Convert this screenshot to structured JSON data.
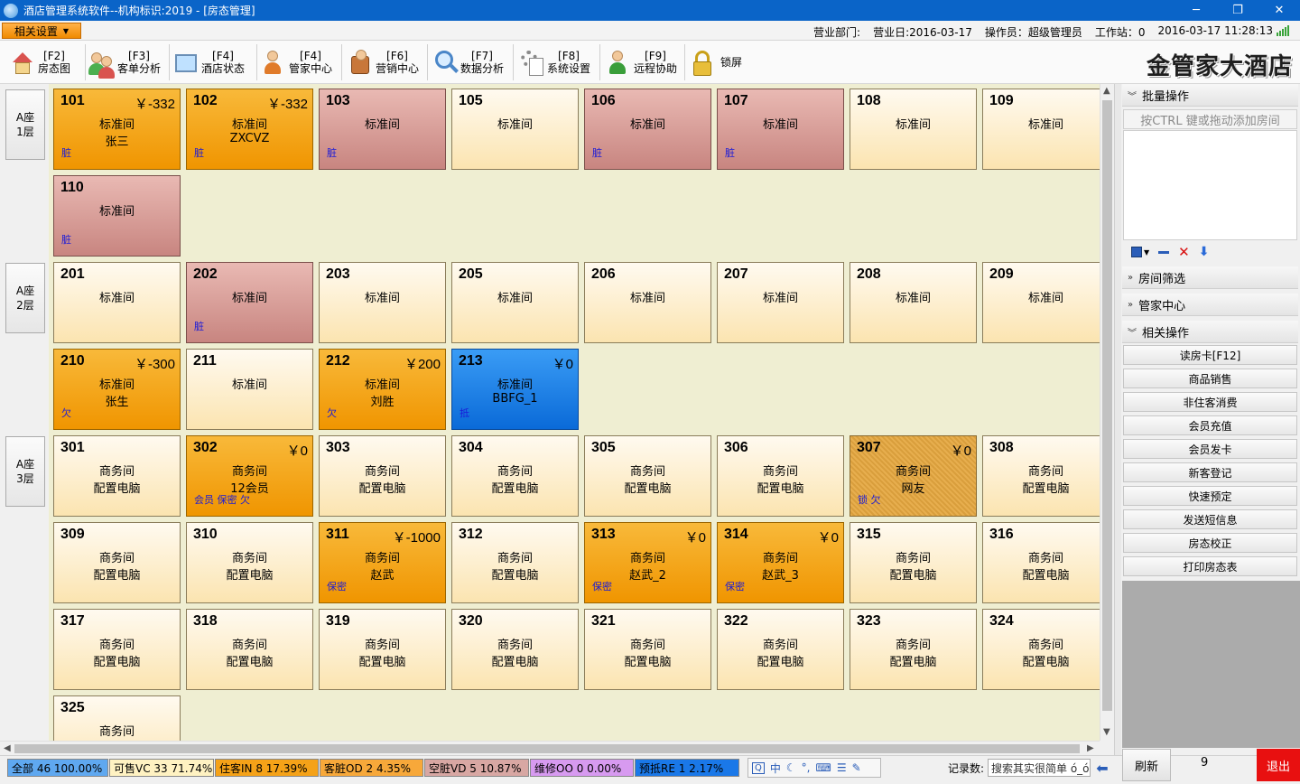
{
  "window": {
    "title": "酒店管理系统软件--机构标识:2019 - [房态管理]",
    "min": "─",
    "restore": "❐",
    "close": "✕"
  },
  "infobar": {
    "menu_label": "相关设置",
    "dept": "营业部门:",
    "business_day": "营业日:2016-03-17",
    "operator": "操作员：超级管理员",
    "workstation": "工作站：0",
    "datetime": "2016-03-17 11:28:13"
  },
  "toolbar": {
    "items": [
      {
        "key": "[F2]",
        "label": "房态图",
        "icon": "house-icon"
      },
      {
        "key": "[F3]",
        "label": "客单分析",
        "icon": "users-icon"
      },
      {
        "key": "[F4]",
        "label": "酒店状态",
        "icon": "monitor-icon"
      },
      {
        "key": "[F4]",
        "label": "管家中心",
        "icon": "butler-icon"
      },
      {
        "key": "[F6]",
        "label": "营销中心",
        "icon": "briefcase-icon"
      },
      {
        "key": "[F7]",
        "label": "数据分析",
        "icon": "magnifier-icon"
      },
      {
        "key": "[F8]",
        "label": "系统设置",
        "icon": "gear-icon"
      },
      {
        "key": "[F9]",
        "label": "远程协助",
        "icon": "support-icon"
      },
      {
        "key": "",
        "label": "锁屏",
        "icon": "lock-icon"
      }
    ],
    "brand": "金管家大酒店"
  },
  "floors": [
    {
      "line1": "A座",
      "line2": "1层"
    },
    {
      "line1": "A座",
      "line2": "2层"
    },
    {
      "line1": "A座",
      "line2": "3层"
    }
  ],
  "rooms": [
    {
      "num": "101",
      "amount": "￥-332",
      "type": "标准间",
      "guest": "张三",
      "flag": "脏",
      "state": "occ"
    },
    {
      "num": "102",
      "amount": "￥-332",
      "type": "标准间",
      "guest": "ZXCVZ",
      "flag": "脏",
      "state": "occ"
    },
    {
      "num": "103",
      "amount": "",
      "type": "标准间",
      "guest": "",
      "flag": "脏",
      "state": "dirty"
    },
    {
      "num": "105",
      "amount": "",
      "type": "标准间",
      "guest": "",
      "flag": "",
      "state": "vacant"
    },
    {
      "num": "106",
      "amount": "",
      "type": "标准间",
      "guest": "",
      "flag": "脏",
      "state": "dirty"
    },
    {
      "num": "107",
      "amount": "",
      "type": "标准间",
      "guest": "",
      "flag": "脏",
      "state": "dirty"
    },
    {
      "num": "108",
      "amount": "",
      "type": "标准间",
      "guest": "",
      "flag": "",
      "state": "vacant"
    },
    {
      "num": "109",
      "amount": "",
      "type": "标准间",
      "guest": "",
      "flag": "",
      "state": "vacant"
    },
    {
      "num": "110",
      "amount": "",
      "type": "标准间",
      "guest": "",
      "flag": "脏",
      "state": "dirty"
    },
    {
      "num": "201",
      "amount": "",
      "type": "标准间",
      "guest": "",
      "flag": "",
      "state": "vacant"
    },
    {
      "num": "202",
      "amount": "",
      "type": "标准间",
      "guest": "",
      "flag": "脏",
      "state": "dirty"
    },
    {
      "num": "203",
      "amount": "",
      "type": "标准间",
      "guest": "",
      "flag": "",
      "state": "vacant"
    },
    {
      "num": "205",
      "amount": "",
      "type": "标准间",
      "guest": "",
      "flag": "",
      "state": "vacant"
    },
    {
      "num": "206",
      "amount": "",
      "type": "标准间",
      "guest": "",
      "flag": "",
      "state": "vacant"
    },
    {
      "num": "207",
      "amount": "",
      "type": "标准间",
      "guest": "",
      "flag": "",
      "state": "vacant"
    },
    {
      "num": "208",
      "amount": "",
      "type": "标准间",
      "guest": "",
      "flag": "",
      "state": "vacant"
    },
    {
      "num": "209",
      "amount": "",
      "type": "标准间",
      "guest": "",
      "flag": "",
      "state": "vacant"
    },
    {
      "num": "210",
      "amount": "￥-300",
      "type": "标准间",
      "guest": "张生",
      "flag": "欠",
      "state": "occ"
    },
    {
      "num": "211",
      "amount": "",
      "type": "标准间",
      "guest": "",
      "flag": "",
      "state": "vacant"
    },
    {
      "num": "212",
      "amount": "￥200",
      "type": "标准间",
      "guest": "刘胜",
      "flag": "欠",
      "state": "occ"
    },
    {
      "num": "213",
      "amount": "￥0",
      "type": "标准间",
      "guest": "BBFG_1",
      "flag": "抵",
      "state": "res"
    },
    {
      "num": "301",
      "amount": "",
      "type": "商务间",
      "guest": "配置电脑",
      "flag": "",
      "state": "vacant"
    },
    {
      "num": "302",
      "amount": "￥0",
      "type": "商务间",
      "guest": "12会员",
      "flag": "会员 保密 欠",
      "state": "occ"
    },
    {
      "num": "303",
      "amount": "",
      "type": "商务间",
      "guest": "配置电脑",
      "flag": "",
      "state": "vacant"
    },
    {
      "num": "304",
      "amount": "",
      "type": "商务间",
      "guest": "配置电脑",
      "flag": "",
      "state": "vacant"
    },
    {
      "num": "305",
      "amount": "",
      "type": "商务间",
      "guest": "配置电脑",
      "flag": "",
      "state": "vacant"
    },
    {
      "num": "306",
      "amount": "",
      "type": "商务间",
      "guest": "配置电脑",
      "flag": "",
      "state": "vacant"
    },
    {
      "num": "307",
      "amount": "￥0",
      "type": "商务间",
      "guest": "网友",
      "flag": "锁 欠",
      "state": "lock"
    },
    {
      "num": "308",
      "amount": "",
      "type": "商务间",
      "guest": "配置电脑",
      "flag": "",
      "state": "vacant"
    },
    {
      "num": "309",
      "amount": "",
      "type": "商务间",
      "guest": "配置电脑",
      "flag": "",
      "state": "vacant"
    },
    {
      "num": "310",
      "amount": "",
      "type": "商务间",
      "guest": "配置电脑",
      "flag": "",
      "state": "vacant"
    },
    {
      "num": "311",
      "amount": "￥-1000",
      "type": "商务间",
      "guest": "赵武",
      "flag": "保密",
      "state": "occ"
    },
    {
      "num": "312",
      "amount": "",
      "type": "商务间",
      "guest": "配置电脑",
      "flag": "",
      "state": "vacant"
    },
    {
      "num": "313",
      "amount": "￥0",
      "type": "商务间",
      "guest": "赵武_2",
      "flag": "保密",
      "state": "occ"
    },
    {
      "num": "314",
      "amount": "￥0",
      "type": "商务间",
      "guest": "赵武_3",
      "flag": "保密",
      "state": "occ"
    },
    {
      "num": "315",
      "amount": "",
      "type": "商务间",
      "guest": "配置电脑",
      "flag": "",
      "state": "vacant"
    },
    {
      "num": "316",
      "amount": "",
      "type": "商务间",
      "guest": "配置电脑",
      "flag": "",
      "state": "vacant"
    },
    {
      "num": "317",
      "amount": "",
      "type": "商务间",
      "guest": "配置电脑",
      "flag": "",
      "state": "vacant"
    },
    {
      "num": "318",
      "amount": "",
      "type": "商务间",
      "guest": "配置电脑",
      "flag": "",
      "state": "vacant"
    },
    {
      "num": "319",
      "amount": "",
      "type": "商务间",
      "guest": "配置电脑",
      "flag": "",
      "state": "vacant"
    },
    {
      "num": "320",
      "amount": "",
      "type": "商务间",
      "guest": "配置电脑",
      "flag": "",
      "state": "vacant"
    },
    {
      "num": "321",
      "amount": "",
      "type": "商务间",
      "guest": "配置电脑",
      "flag": "",
      "state": "vacant"
    },
    {
      "num": "322",
      "amount": "",
      "type": "商务间",
      "guest": "配置电脑",
      "flag": "",
      "state": "vacant"
    },
    {
      "num": "323",
      "amount": "",
      "type": "商务间",
      "guest": "配置电脑",
      "flag": "",
      "state": "vacant"
    },
    {
      "num": "324",
      "amount": "",
      "type": "商务间",
      "guest": "配置电脑",
      "flag": "",
      "state": "vacant"
    },
    {
      "num": "325",
      "amount": "",
      "type": "商务间",
      "guest": "",
      "flag": "",
      "state": "vacant"
    }
  ],
  "right_panel": {
    "batch_title": "批量操作",
    "batch_hint": "按CTRL 键或拖动添加房间",
    "filter_title": "房间筛选",
    "butler_title": "管家中心",
    "ops_title": "相关操作",
    "ops": [
      "读房卡[F12]",
      "商品销售",
      "非住客消费",
      "会员充值",
      "会员发卡",
      "新客登记",
      "快速预定",
      "发送短信息",
      "房态校正",
      "打印房态表"
    ]
  },
  "stats": [
    {
      "label": "全部 46 100.00%",
      "color": "#5fa8f0"
    },
    {
      "label": "可售VC 33 71.74%",
      "color": "#fff2c2"
    },
    {
      "label": "住客IN 8 17.39%",
      "color": "#f5a218"
    },
    {
      "label": "客脏OD 2 4.35%",
      "color": "#f7a83a"
    },
    {
      "label": "空脏VD 5 10.87%",
      "color": "#d8a7a3"
    },
    {
      "label": "维修OO 0 0.00%",
      "color": "#d79af0"
    },
    {
      "label": "预抵RE 1 2.17%",
      "color": "#1a78e8"
    }
  ],
  "bottom": {
    "ime_lang": "中",
    "record_label": "记录数:",
    "search_placeholder": "搜索其实很简单 ó_ó",
    "refresh": "刷新",
    "total": "9",
    "exit": "退出"
  }
}
